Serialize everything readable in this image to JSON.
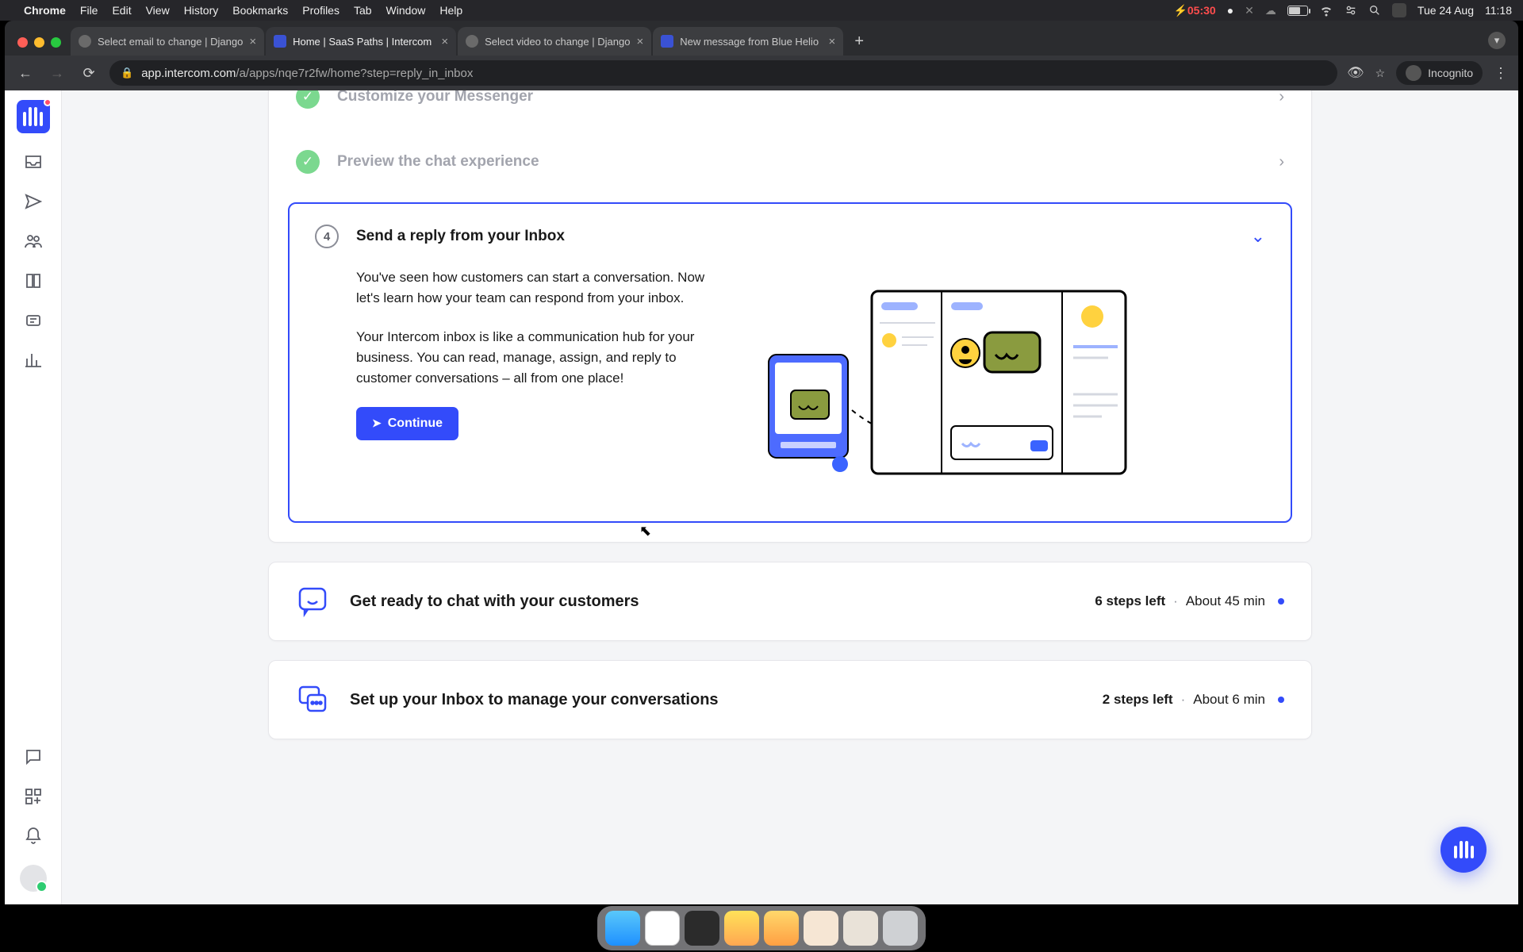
{
  "macos": {
    "app_name": "Chrome",
    "menus": [
      "File",
      "Edit",
      "View",
      "History",
      "Bookmarks",
      "Profiles",
      "Tab",
      "Window",
      "Help"
    ],
    "timer": "05:30",
    "date": "Tue 24 Aug",
    "time": "11:18"
  },
  "browser": {
    "tabs": [
      {
        "title": "Select email to change | Django",
        "icon": "globe"
      },
      {
        "title": "Home | SaaS Paths | Intercom",
        "icon": "intercom",
        "active": true
      },
      {
        "title": "Select video to change | Django",
        "icon": "globe"
      },
      {
        "title": "New message from Blue Helio",
        "icon": "intercom"
      }
    ],
    "url_host": "app.intercom.com",
    "url_path": "/a/apps/nqe7r2fw/home?step=reply_in_inbox",
    "profile_label": "Incognito"
  },
  "steps": {
    "done": [
      {
        "title": "Customize your Messenger"
      },
      {
        "title": "Preview the chat experience"
      }
    ],
    "active": {
      "number": "4",
      "title": "Send a reply from your Inbox",
      "para1": "You've seen how customers can start a conversation. Now let's learn how your team can respond from your inbox.",
      "para2": "Your Intercom inbox is like a communication hub for your business. You can read, manage, assign, and reply to customer conversations – all from one place!",
      "cta": "Continue"
    }
  },
  "task_cards": [
    {
      "title": "Get ready to chat with your customers",
      "steps_left": "6 steps left",
      "eta": "About 45 min"
    },
    {
      "title": "Set up your Inbox to manage your conversations",
      "steps_left": "2 steps left",
      "eta": "About 6 min"
    }
  ]
}
